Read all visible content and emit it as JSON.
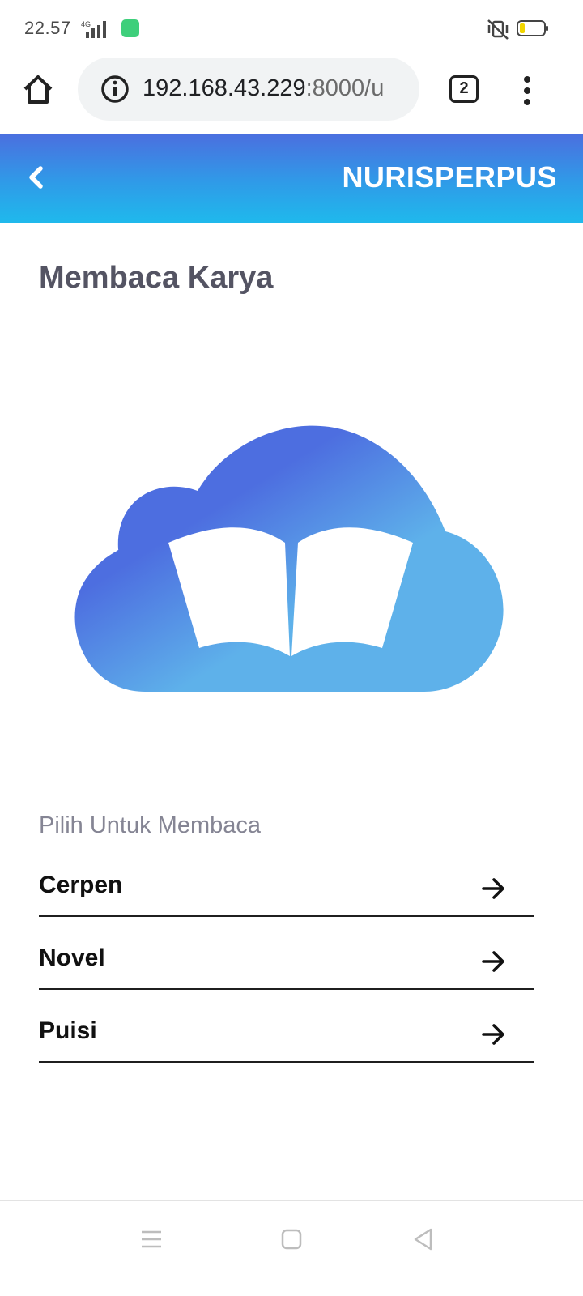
{
  "status": {
    "time": "22.57",
    "network": "4G",
    "battery_color": "#f1d500"
  },
  "browser": {
    "url_host": "192.168.43.229",
    "url_rest": ":8000/u",
    "tab_count": "2",
    "icons": [
      "home-icon",
      "info-icon",
      "tab-switcher-icon",
      "more-vert-icon"
    ]
  },
  "header": {
    "brand": "NURISPERPUS",
    "gradient_top": "#4b6fdf",
    "gradient_bottom": "#1fb9ec"
  },
  "main": {
    "title": "Membaca Karya",
    "section_label": "Pilih Untuk Membaca",
    "items": [
      {
        "label": "Cerpen"
      },
      {
        "label": "Novel"
      },
      {
        "label": "Puisi"
      }
    ],
    "hero_colors": [
      "#4d6ee0",
      "#5eb1ea"
    ]
  },
  "nav": {
    "icons": [
      "menu-icon",
      "home-square-icon",
      "back-triangle-icon"
    ]
  }
}
